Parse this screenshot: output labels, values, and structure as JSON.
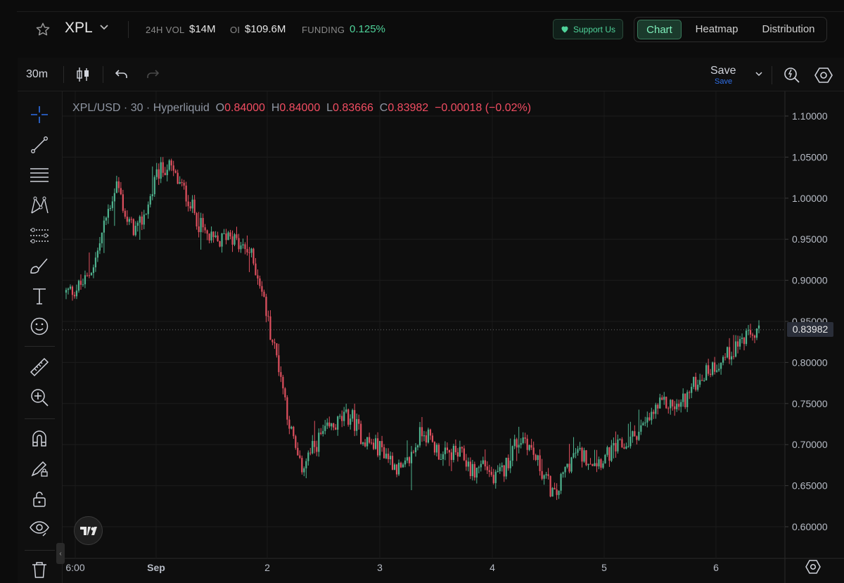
{
  "header": {
    "pair": "XPL",
    "stats": [
      {
        "label": "24H VOL",
        "value": "$14M"
      },
      {
        "label": "OI",
        "value": "$109.6M"
      },
      {
        "label": "FUNDING",
        "value": "0.125%"
      }
    ],
    "support_label": "Support Us",
    "tabs": [
      "Chart",
      "Heatmap",
      "Distribution"
    ],
    "active_tab": "Chart",
    "colors": {
      "positive": "#4fd39a",
      "accent_green": "#7ff0bc"
    }
  },
  "toolbar": {
    "interval": "30m",
    "save_label": "Save",
    "save_sublabel": "Save"
  },
  "legend": {
    "symbol": "XPL/USD · 30 · Hyperliquid",
    "open_key": "O",
    "open": "0.84000",
    "high_key": "H",
    "high": "0.84000",
    "low_key": "L",
    "low": "0.83666",
    "close_key": "C",
    "close": "0.83982",
    "change": "−0.00018 (−0.02%)"
  },
  "left_tools": [
    "crosshair-icon",
    "trendline-icon",
    "fib-retracement-icon",
    "pattern-icon",
    "prediction-icon",
    "brush-icon",
    "text-icon",
    "emoji-icon",
    "ruler-icon",
    "zoom-in-icon",
    "magnet-icon",
    "lock-drawing-icon",
    "unlock-icon",
    "eye-icon",
    "trash-icon"
  ],
  "chart_data": {
    "type": "candlestick",
    "symbol": "XPL/USD",
    "interval": "30",
    "y_ticks": [
      "1.10000",
      "1.05000",
      "1.00000",
      "0.95000",
      "0.90000",
      "0.85000",
      "0.80000",
      "0.75000",
      "0.70000",
      "0.65000",
      "0.60000"
    ],
    "ylim": [
      0.56,
      1.12
    ],
    "x_ticks": [
      "6:00",
      "Sep",
      "2",
      "3",
      "4",
      "5",
      "6"
    ],
    "last_price": "0.83982",
    "colors": {
      "up": "#4fb38f",
      "down": "#e0505f"
    },
    "path_close": [
      0.885,
      0.89,
      0.9,
      0.93,
      0.98,
      1.02,
      0.97,
      0.96,
      0.99,
      1.03,
      1.04,
      1.02,
      1.0,
      0.97,
      0.95,
      0.945,
      0.96,
      0.94,
      0.935,
      0.9,
      0.84,
      0.79,
      0.72,
      0.67,
      0.69,
      0.71,
      0.72,
      0.73,
      0.735,
      0.71,
      0.7,
      0.695,
      0.68,
      0.665,
      0.69,
      0.72,
      0.7,
      0.685,
      0.69,
      0.685,
      0.665,
      0.68,
      0.655,
      0.67,
      0.7,
      0.71,
      0.685,
      0.66,
      0.635,
      0.67,
      0.69,
      0.685,
      0.68,
      0.685,
      0.695,
      0.7,
      0.715,
      0.725,
      0.745,
      0.75,
      0.745,
      0.76,
      0.78,
      0.79,
      0.8,
      0.81,
      0.825,
      0.83,
      0.84
    ],
    "path_high": [
      0.9,
      0.91,
      0.93,
      0.97,
      1.07,
      1.05,
      1.0,
      0.99,
      1.04,
      1.045,
      1.05,
      1.03,
      1.02,
      0.99,
      0.97,
      0.96,
      0.98,
      0.96,
      0.95,
      0.93,
      0.86,
      0.82,
      0.75,
      0.72,
      0.73,
      0.74,
      0.76,
      0.77,
      0.75,
      0.73,
      0.72,
      0.72,
      0.7,
      0.69,
      0.73,
      0.73,
      0.72,
      0.71,
      0.71,
      0.7,
      0.69,
      0.7,
      0.68,
      0.7,
      0.72,
      0.72,
      0.7,
      0.68,
      0.67,
      0.7,
      0.71,
      0.7,
      0.7,
      0.7,
      0.72,
      0.73,
      0.73,
      0.83,
      0.79,
      0.78,
      0.77,
      0.78,
      0.8,
      0.8,
      0.82,
      0.83,
      0.84,
      0.84,
      0.845
    ],
    "path_low": [
      0.88,
      0.88,
      0.89,
      0.91,
      0.94,
      0.97,
      0.95,
      0.94,
      0.97,
      1.01,
      1.0,
      0.99,
      0.97,
      0.94,
      0.93,
      0.93,
      0.94,
      0.93,
      0.91,
      0.87,
      0.79,
      0.72,
      0.63,
      0.64,
      0.67,
      0.69,
      0.7,
      0.71,
      0.7,
      0.69,
      0.68,
      0.67,
      0.65,
      0.61,
      0.64,
      0.69,
      0.68,
      0.67,
      0.67,
      0.66,
      0.64,
      0.66,
      0.64,
      0.65,
      0.68,
      0.68,
      0.65,
      0.62,
      0.63,
      0.66,
      0.67,
      0.67,
      0.67,
      0.67,
      0.68,
      0.69,
      0.7,
      0.7,
      0.73,
      0.73,
      0.72,
      0.74,
      0.77,
      0.78,
      0.79,
      0.8,
      0.81,
      0.81,
      0.82
    ]
  }
}
